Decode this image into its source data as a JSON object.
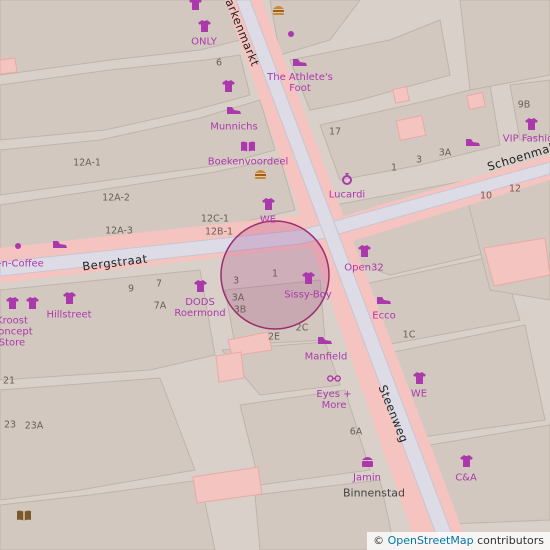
{
  "map": {
    "colors": {
      "background": "#d9d0c9",
      "pedestrian": "#dddde8",
      "pedestrian_outline": "#c7c7cf",
      "footway": "#f7c5c0",
      "building": "#d0c6bd",
      "shop_label": "#ac39ac",
      "marker_fill": "#a0287d",
      "marker_stroke": "#9b2e6f"
    },
    "streets": [
      {
        "id": "bergstraat",
        "name": "Bergstraat"
      },
      {
        "id": "steenweg",
        "name": "Steenweg"
      },
      {
        "id": "markt",
        "name": "Markenmarkt"
      },
      {
        "id": "schoenmakers",
        "name": "Schoenmak"
      }
    ],
    "shops": [
      {
        "id": "only",
        "name": "ONLY",
        "icon": "clothes-icon"
      },
      {
        "id": "athletes_foot",
        "name": "The Athlete's Foot",
        "icon": "shoe-icon"
      },
      {
        "id": "munnichs",
        "name": "Munnichs",
        "icon": "shoe-icon"
      },
      {
        "id": "boekenvoordeel",
        "name": "Boekenvoordeel",
        "icon": "book-icon"
      },
      {
        "id": "lucardi",
        "name": "Lucardi",
        "icon": "ring-icon"
      },
      {
        "id": "vip_fashion",
        "name": "VIP Fashio",
        "icon": "clothes-icon"
      },
      {
        "id": "we_top",
        "name": "WE",
        "icon": "clothes-icon"
      },
      {
        "id": "open32",
        "name": "Open32",
        "icon": "clothes-icon"
      },
      {
        "id": "sissy_boy",
        "name": "Sissy-Boy",
        "icon": "clothes-icon"
      },
      {
        "id": "dods",
        "name": "DODS Roermond",
        "icon": "clothes-icon"
      },
      {
        "id": "ecco",
        "name": "Ecco",
        "icon": "shoe-icon"
      },
      {
        "id": "manfield",
        "name": "Manfield",
        "icon": "shoe-icon"
      },
      {
        "id": "eyes_more",
        "name": "Eyes + More",
        "icon": "glasses-icon"
      },
      {
        "id": "we_right",
        "name": "WE",
        "icon": "clothes-icon"
      },
      {
        "id": "jamin",
        "name": "Jamin",
        "icon": "candy-icon"
      },
      {
        "id": "ca",
        "name": "C&A",
        "icon": "clothes-icon"
      },
      {
        "id": "hillstreet",
        "name": "Hillstreet",
        "icon": "clothes-icon"
      },
      {
        "id": "kroost",
        "name": "Kroost Concept Store",
        "icon": "clothes-icon"
      },
      {
        "id": "coffee",
        "name": "k-n-Coffee",
        "icon": "cafe-icon"
      }
    ],
    "house_numbers": [
      "6",
      "17",
      "1",
      "3",
      "3A",
      "9B",
      "10",
      "12",
      "12A-1",
      "12A-2",
      "12A-3",
      "12C-1",
      "12B-1",
      "9",
      "7",
      "7A",
      "3",
      "3A",
      "3B",
      "1",
      "2E",
      "2C",
      "1C",
      "6A",
      "21",
      "23",
      "23A"
    ],
    "places": [
      {
        "id": "binnenstad",
        "name": "Binnenstad"
      }
    ],
    "attribution": {
      "symbol": "©",
      "link_text": "OpenStreetMap",
      "suffix": "contributors"
    }
  }
}
